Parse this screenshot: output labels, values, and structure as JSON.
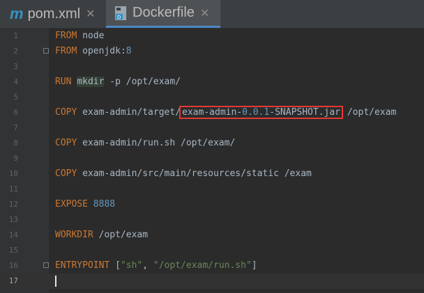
{
  "tabs": [
    {
      "label": "pom.xml",
      "icon": "m-icon",
      "active": false
    },
    {
      "label": "Dockerfile",
      "icon": "docker-icon",
      "active": true
    }
  ],
  "line_numbers": [
    "1",
    "2",
    "3",
    "4",
    "5",
    "6",
    "7",
    "8",
    "9",
    "10",
    "11",
    "12",
    "13",
    "14",
    "15",
    "16",
    "17"
  ],
  "code": {
    "l1": {
      "kw": "FROM",
      "rest": " node"
    },
    "l2": {
      "kw": "FROM",
      "rest": " openjdk:",
      "num": "8"
    },
    "l4": {
      "kw": "RUN",
      "cmd": "mkdir",
      "rest": " -p /opt/exam/"
    },
    "l6": {
      "kw": "COPY",
      "rest": " exam-admin/target/",
      "hl_a": "exam-admin-",
      "hl_num": "0.0.1",
      "hl_b": "-SNAPSHOT.jar",
      "tail": " /opt/exam"
    },
    "l8": {
      "kw": "COPY",
      "rest": " exam-admin/run.sh /opt/exam/"
    },
    "l10": {
      "kw": "COPY",
      "rest": " exam-admin/src/main/resources/static /exam"
    },
    "l12": {
      "kw": "EXPOSE",
      "num": "8888"
    },
    "l14": {
      "kw": "WORKDIR",
      "rest": " /opt/exam"
    },
    "l16": {
      "kw": "ENTRYPOINT",
      "p1": " [",
      "s1": "\"sh\"",
      "p2": ", ",
      "s2": "\"/opt/exam/run.sh\"",
      "p3": "]"
    }
  }
}
